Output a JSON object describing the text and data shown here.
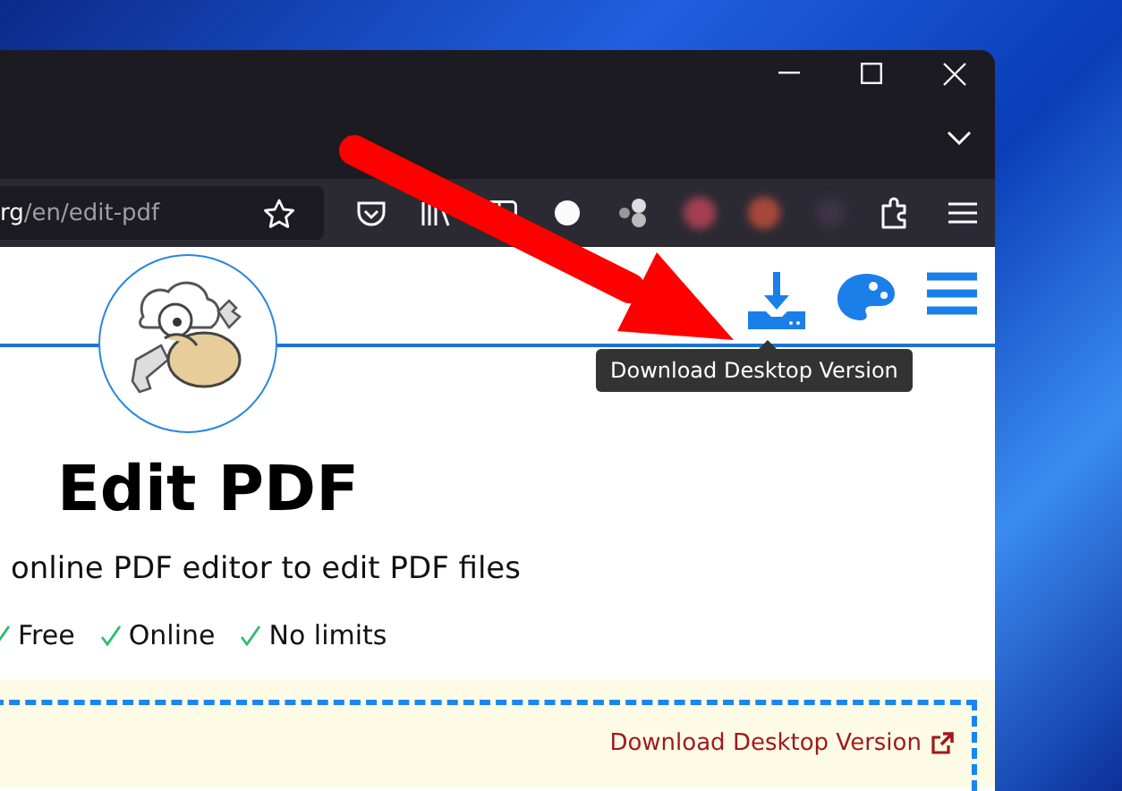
{
  "browser": {
    "domain": "rg",
    "path": "/en/edit-pdf"
  },
  "page": {
    "tooltip": "Download Desktop Version",
    "title": "Edit PDF",
    "subtitle": "online PDF editor to edit PDF files",
    "features": [
      {
        "label": "Free"
      },
      {
        "label": "Online"
      },
      {
        "label": "No limits"
      }
    ],
    "upload_box": {
      "link": "Download Desktop Version"
    }
  }
}
